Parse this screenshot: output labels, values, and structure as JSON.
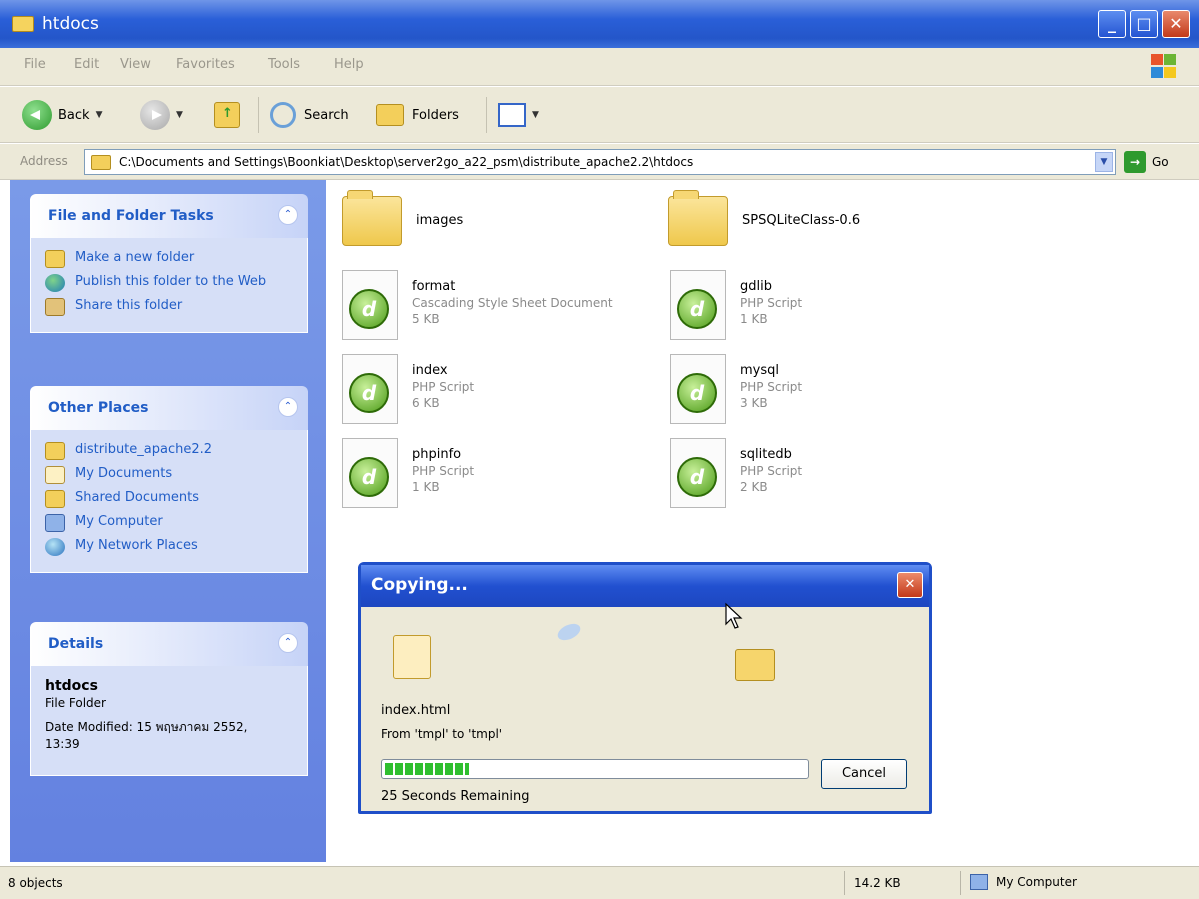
{
  "window": {
    "title": "htdocs"
  },
  "menu": [
    "File",
    "Edit",
    "View",
    "Favorites",
    "Tools",
    "Help"
  ],
  "toolbar": {
    "back": "Back",
    "search": "Search",
    "folders": "Folders"
  },
  "address": {
    "label": "Address",
    "value": "C:\\Documents and Settings\\Boonkiat\\Desktop\\server2go_a22_psm\\distribute_apache2.2\\htdocs",
    "go": "Go"
  },
  "tasks": {
    "title": "File and Folder Tasks",
    "items": [
      "Make a new folder",
      "Publish this folder to the Web",
      "Share this folder"
    ]
  },
  "places": {
    "title": "Other Places",
    "items": [
      "distribute_apache2.2",
      "My Documents",
      "Shared Documents",
      "My Computer",
      "My Network Places"
    ]
  },
  "details": {
    "title": "Details",
    "name": "htdocs",
    "type": "File Folder",
    "modified": "Date Modified: 15 พฤษภาคม 2552, 13:39"
  },
  "files": [
    {
      "name": "images",
      "type": "",
      "size": ""
    },
    {
      "name": "SPSQLiteClass-0.6",
      "type": "",
      "size": ""
    },
    {
      "name": "format",
      "type": "Cascading Style Sheet Document",
      "size": "5 KB"
    },
    {
      "name": "gdlib",
      "type": "PHP Script",
      "size": "1 KB"
    },
    {
      "name": "index",
      "type": "PHP Script",
      "size": "6 KB"
    },
    {
      "name": "mysql",
      "type": "PHP Script",
      "size": "3 KB"
    },
    {
      "name": "phpinfo",
      "type": "PHP Script",
      "size": "1 KB"
    },
    {
      "name": "sqlitedb",
      "type": "PHP Script",
      "size": "2 KB"
    }
  ],
  "dialog": {
    "title": "Copying...",
    "file": "index.html",
    "from": "From 'tmpl' to 'tmpl'",
    "progress": 0.2,
    "cancel": "Cancel",
    "remaining": "25 Seconds Remaining"
  },
  "status": {
    "objects": "8 objects",
    "size": "14.2 KB",
    "location": "My Computer"
  }
}
